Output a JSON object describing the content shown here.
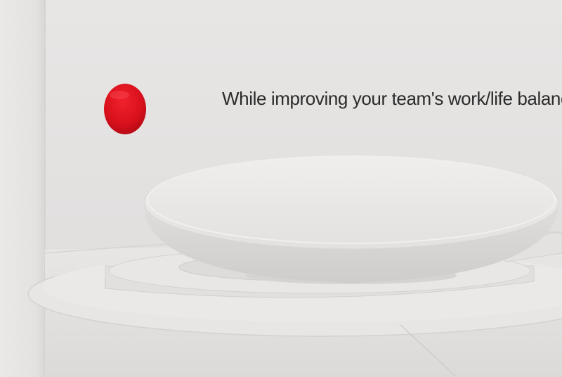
{
  "headline": "While improving your team's work/life balance",
  "colors": {
    "background": "#e6e4e3",
    "accent_dot": "#d8101c",
    "text": "#2b2b2b"
  }
}
